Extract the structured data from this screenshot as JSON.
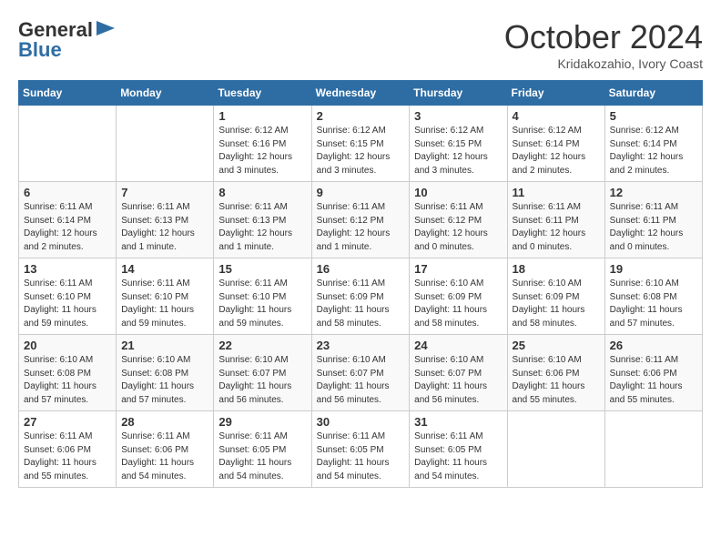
{
  "header": {
    "logo_general": "General",
    "logo_blue": "Blue",
    "month_title": "October 2024",
    "location": "Kridakozahio, Ivory Coast"
  },
  "days_of_week": [
    "Sunday",
    "Monday",
    "Tuesday",
    "Wednesday",
    "Thursday",
    "Friday",
    "Saturday"
  ],
  "weeks": [
    [
      {
        "day": "",
        "info": ""
      },
      {
        "day": "",
        "info": ""
      },
      {
        "day": "1",
        "info": "Sunrise: 6:12 AM\nSunset: 6:16 PM\nDaylight: 12 hours and 3 minutes."
      },
      {
        "day": "2",
        "info": "Sunrise: 6:12 AM\nSunset: 6:15 PM\nDaylight: 12 hours and 3 minutes."
      },
      {
        "day": "3",
        "info": "Sunrise: 6:12 AM\nSunset: 6:15 PM\nDaylight: 12 hours and 3 minutes."
      },
      {
        "day": "4",
        "info": "Sunrise: 6:12 AM\nSunset: 6:14 PM\nDaylight: 12 hours and 2 minutes."
      },
      {
        "day": "5",
        "info": "Sunrise: 6:12 AM\nSunset: 6:14 PM\nDaylight: 12 hours and 2 minutes."
      }
    ],
    [
      {
        "day": "6",
        "info": "Sunrise: 6:11 AM\nSunset: 6:14 PM\nDaylight: 12 hours and 2 minutes."
      },
      {
        "day": "7",
        "info": "Sunrise: 6:11 AM\nSunset: 6:13 PM\nDaylight: 12 hours and 1 minute."
      },
      {
        "day": "8",
        "info": "Sunrise: 6:11 AM\nSunset: 6:13 PM\nDaylight: 12 hours and 1 minute."
      },
      {
        "day": "9",
        "info": "Sunrise: 6:11 AM\nSunset: 6:12 PM\nDaylight: 12 hours and 1 minute."
      },
      {
        "day": "10",
        "info": "Sunrise: 6:11 AM\nSunset: 6:12 PM\nDaylight: 12 hours and 0 minutes."
      },
      {
        "day": "11",
        "info": "Sunrise: 6:11 AM\nSunset: 6:11 PM\nDaylight: 12 hours and 0 minutes."
      },
      {
        "day": "12",
        "info": "Sunrise: 6:11 AM\nSunset: 6:11 PM\nDaylight: 12 hours and 0 minutes."
      }
    ],
    [
      {
        "day": "13",
        "info": "Sunrise: 6:11 AM\nSunset: 6:10 PM\nDaylight: 11 hours and 59 minutes."
      },
      {
        "day": "14",
        "info": "Sunrise: 6:11 AM\nSunset: 6:10 PM\nDaylight: 11 hours and 59 minutes."
      },
      {
        "day": "15",
        "info": "Sunrise: 6:11 AM\nSunset: 6:10 PM\nDaylight: 11 hours and 59 minutes."
      },
      {
        "day": "16",
        "info": "Sunrise: 6:11 AM\nSunset: 6:09 PM\nDaylight: 11 hours and 58 minutes."
      },
      {
        "day": "17",
        "info": "Sunrise: 6:10 AM\nSunset: 6:09 PM\nDaylight: 11 hours and 58 minutes."
      },
      {
        "day": "18",
        "info": "Sunrise: 6:10 AM\nSunset: 6:09 PM\nDaylight: 11 hours and 58 minutes."
      },
      {
        "day": "19",
        "info": "Sunrise: 6:10 AM\nSunset: 6:08 PM\nDaylight: 11 hours and 57 minutes."
      }
    ],
    [
      {
        "day": "20",
        "info": "Sunrise: 6:10 AM\nSunset: 6:08 PM\nDaylight: 11 hours and 57 minutes."
      },
      {
        "day": "21",
        "info": "Sunrise: 6:10 AM\nSunset: 6:08 PM\nDaylight: 11 hours and 57 minutes."
      },
      {
        "day": "22",
        "info": "Sunrise: 6:10 AM\nSunset: 6:07 PM\nDaylight: 11 hours and 56 minutes."
      },
      {
        "day": "23",
        "info": "Sunrise: 6:10 AM\nSunset: 6:07 PM\nDaylight: 11 hours and 56 minutes."
      },
      {
        "day": "24",
        "info": "Sunrise: 6:10 AM\nSunset: 6:07 PM\nDaylight: 11 hours and 56 minutes."
      },
      {
        "day": "25",
        "info": "Sunrise: 6:10 AM\nSunset: 6:06 PM\nDaylight: 11 hours and 55 minutes."
      },
      {
        "day": "26",
        "info": "Sunrise: 6:11 AM\nSunset: 6:06 PM\nDaylight: 11 hours and 55 minutes."
      }
    ],
    [
      {
        "day": "27",
        "info": "Sunrise: 6:11 AM\nSunset: 6:06 PM\nDaylight: 11 hours and 55 minutes."
      },
      {
        "day": "28",
        "info": "Sunrise: 6:11 AM\nSunset: 6:06 PM\nDaylight: 11 hours and 54 minutes."
      },
      {
        "day": "29",
        "info": "Sunrise: 6:11 AM\nSunset: 6:05 PM\nDaylight: 11 hours and 54 minutes."
      },
      {
        "day": "30",
        "info": "Sunrise: 6:11 AM\nSunset: 6:05 PM\nDaylight: 11 hours and 54 minutes."
      },
      {
        "day": "31",
        "info": "Sunrise: 6:11 AM\nSunset: 6:05 PM\nDaylight: 11 hours and 54 minutes."
      },
      {
        "day": "",
        "info": ""
      },
      {
        "day": "",
        "info": ""
      }
    ]
  ]
}
